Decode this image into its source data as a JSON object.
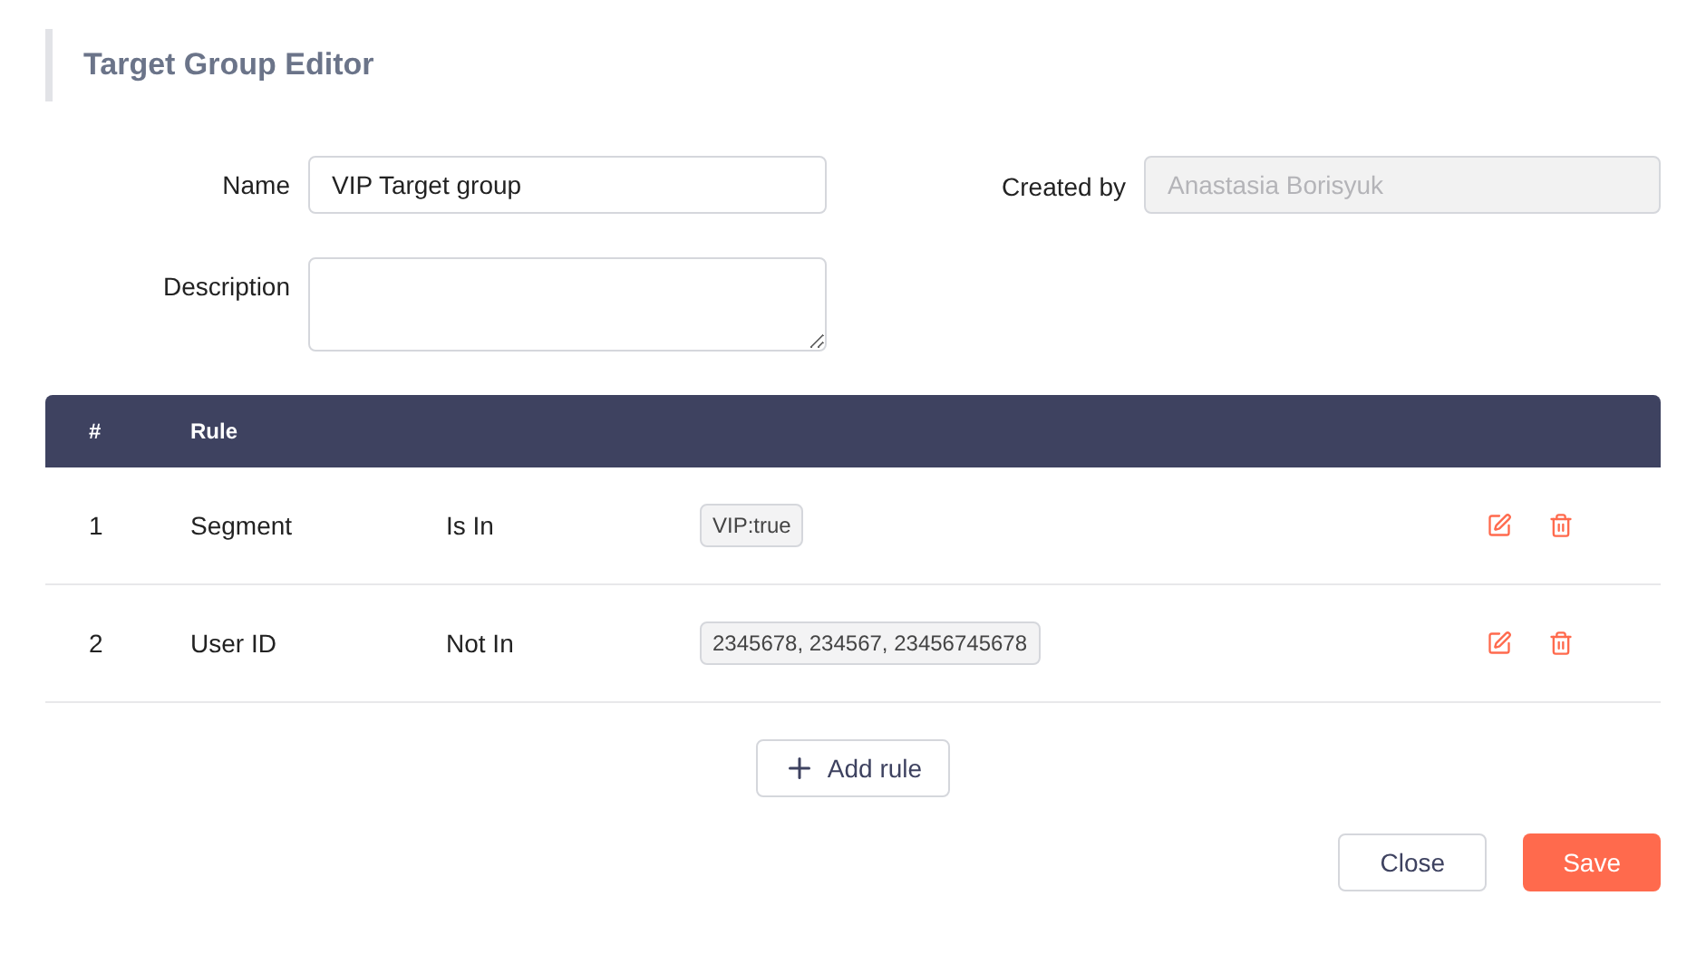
{
  "title": "Target Group Editor",
  "name_field": {
    "label": "Name",
    "value": "VIP Target group"
  },
  "created_by_field": {
    "label": "Created by",
    "value": "Anastasia Borisyuk",
    "disabled": true
  },
  "description_field": {
    "label": "Description"
  },
  "table": {
    "columns": [
      "#",
      "Rule"
    ],
    "rows": [
      {
        "index": "1",
        "field": "Segment",
        "operator": "Is In",
        "value": "VIP:true"
      },
      {
        "index": "2",
        "field": "User ID",
        "operator": "Not In",
        "value": "2345678, 234567, 23456745678"
      }
    ]
  },
  "add_button": "Add rule",
  "buttons": [
    {
      "label": "Close",
      "kind": "secondary"
    },
    {
      "label": "Save",
      "kind": "primary"
    }
  ]
}
